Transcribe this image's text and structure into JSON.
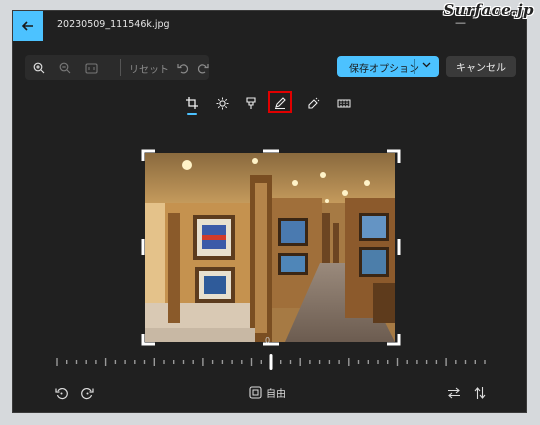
{
  "window": {
    "title": "20230509_111546k.jpg"
  },
  "watermark": "Surface.jp",
  "toolbar": {
    "reset_label": "リセット",
    "save_label": "保存オプション",
    "cancel_label": "キャンセル"
  },
  "tools": [
    "crop-icon",
    "adjust-brightness-icon",
    "filter-icon",
    "markup-icon",
    "retouch-icon",
    "background-blur-icon"
  ],
  "selected_tool": "crop-icon",
  "highlighted_tool": "markup-icon",
  "straighten": {
    "angle_label": "0"
  },
  "bottom": {
    "aspect_label": "自由"
  },
  "colors": {
    "accent": "#4cc2ff",
    "highlight": "#e00000",
    "window_bg": "#202020"
  }
}
